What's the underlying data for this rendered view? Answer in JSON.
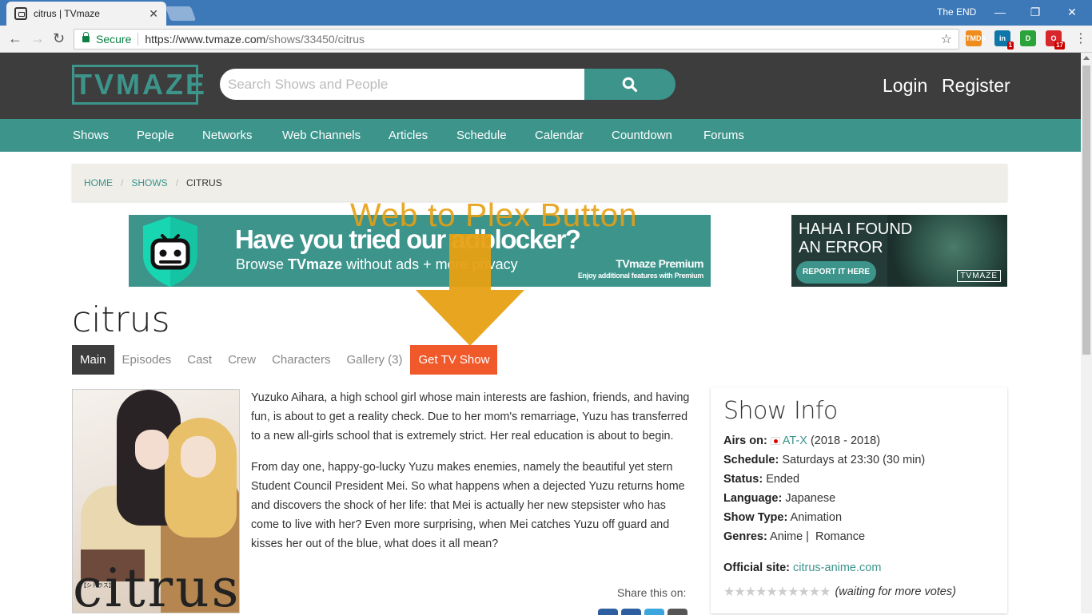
{
  "browser": {
    "tab_title": "citrus | TVmaze",
    "tab_close": "✕",
    "user_name": "The END",
    "secure_label": "Secure",
    "url_host": "https://www.tvmaze.com",
    "url_path": "/shows/33450/citrus",
    "extensions": [
      {
        "name": "tmdb-extension",
        "label": "TMDb",
        "color": "#f08c1e"
      },
      {
        "name": "linkedin-extension",
        "label": "in",
        "badge": "1",
        "color": "#0e76a8"
      },
      {
        "name": "green-extension",
        "label": "D",
        "color": "#2aa33b"
      },
      {
        "name": "red-extension",
        "label": "O",
        "badge": "17",
        "color": "#d8262d"
      }
    ]
  },
  "header": {
    "logo_text": "TVMAZE",
    "search_placeholder": "Search Shows and People",
    "login": "Login",
    "register": "Register"
  },
  "nav": [
    "Shows",
    "People",
    "Networks",
    "Web Channels",
    "Articles",
    "Schedule",
    "Calendar",
    "Countdown",
    "Forums"
  ],
  "breadcrumb": {
    "home": "HOME",
    "shows": "SHOWS",
    "current": "CITRUS",
    "separator": "/"
  },
  "ad_main": {
    "headline": "Have you tried our adblocker?",
    "sub_pre": "Browse ",
    "sub_brand": "TVmaze",
    "sub_post": " without ads + more privacy",
    "premium": "TVmaze Premium",
    "premium_sub": "Enjoy additional features with Premium"
  },
  "ad_side": {
    "title": "HAHA I FOUND AN ERROR",
    "button": "REPORT IT HERE",
    "logo": "TVMAZE"
  },
  "annotation": {
    "text": "Web to Plex Button",
    "color": "#e7a013"
  },
  "show": {
    "title": "citrus",
    "tabs": [
      {
        "label": "Main",
        "state": "active"
      },
      {
        "label": "Episodes",
        "state": ""
      },
      {
        "label": "Cast",
        "state": ""
      },
      {
        "label": "Crew",
        "state": ""
      },
      {
        "label": "Characters",
        "state": ""
      },
      {
        "label": "Gallery (3)",
        "state": ""
      },
      {
        "label": "Get TV Show",
        "state": "promo"
      }
    ],
    "poster_word": "citrus",
    "poster_small": "【シトラス】",
    "summary": [
      "Yuzuko Aihara, a high school girl whose main interests are fashion, friends, and having fun, is about to get a reality check. Due to her mom's remarriage, Yuzu has transferred to a new all-girls school that is extremely strict. Her real education is about to begin.",
      "From day one, happy-go-lucky Yuzu makes enemies, namely the beautiful yet stern Student Council President Mei. So what happens when a dejected Yuzu returns home and discovers the shock of her life: that Mei is actually her new stepsister who has come to live with her? Even more surprising, when Mei catches Yuzu off guard and kisses her out of the blue, what does it all mean?"
    ],
    "share_label": "Share this on:"
  },
  "info": {
    "title": "Show Info",
    "airs_label": "Airs on:",
    "airs_network": "AT-X",
    "airs_years": "(2018 - 2018)",
    "schedule_label": "Schedule:",
    "schedule_value": "Saturdays at 23:30 (30 min)",
    "status_label": "Status:",
    "status_value": "Ended",
    "language_label": "Language:",
    "language_value": "Japanese",
    "type_label": "Show Type:",
    "type_value": "Animation",
    "genres_label": "Genres:",
    "genres_value": "Anime |  Romance",
    "site_label": "Official site:",
    "site_value": "citrus-anime.com",
    "rating_stars": "★★★★★★★★★★",
    "rating_votes": "(waiting for more votes)"
  }
}
